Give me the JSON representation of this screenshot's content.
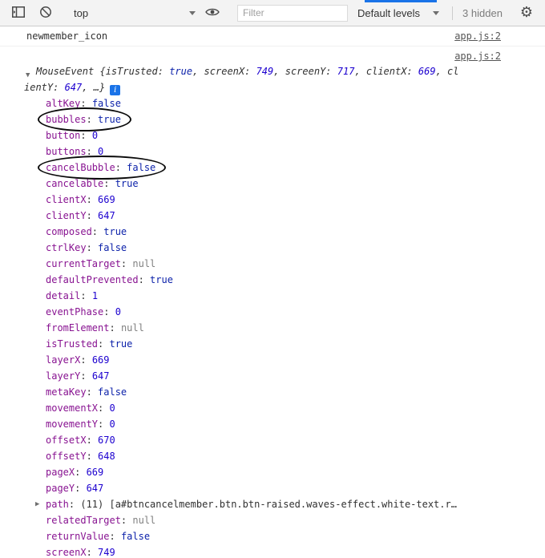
{
  "colors": {
    "accent_blue": "#1a73e8",
    "toolbar_background": "#f3f3f3",
    "property_name": "#881391",
    "number_value": "#1c00cf",
    "boolean_value": "#0d22aa",
    "null_value": "#808080",
    "source_link": "#555555",
    "annotation_circle": "#0a0a0a"
  },
  "icons": {
    "gear": "⚙",
    "expanded_arrow": "▼",
    "collapsed_arrow": "▶",
    "info": "i",
    "clear_console": "no-entry-circle",
    "console_sidebar": "sidebar-panel",
    "live_expression": "eye"
  },
  "toolbar": {
    "context_selector_label": "top",
    "filter_placeholder": "Filter",
    "levels_label": "Default levels",
    "hidden_label": "3 hidden"
  },
  "console": {
    "property_separator": ": ",
    "entry1": {
      "message": "newmember_icon",
      "source": "app.js:2"
    },
    "entry2": {
      "source": "app.js:2",
      "preview_line1": [
        {
          "t": "MouseEvent ",
          "c": "objname"
        },
        {
          "t": "{isTrusted: ",
          "c": "key"
        },
        {
          "t": "true",
          "c": "bool"
        },
        {
          "t": ", screenX: ",
          "c": "key"
        },
        {
          "t": "749",
          "c": "num"
        },
        {
          "t": ", screenY: ",
          "c": "key"
        },
        {
          "t": "717",
          "c": "num"
        },
        {
          "t": ", clientX: ",
          "c": "key"
        },
        {
          "t": "669",
          "c": "num"
        },
        {
          "t": ", cl",
          "c": "key"
        }
      ],
      "preview_line2": [
        {
          "t": "ientY: ",
          "c": "key"
        },
        {
          "t": "647",
          "c": "num"
        },
        {
          "t": ", …}",
          "c": "key"
        }
      ],
      "properties": [
        {
          "name": "altKey",
          "value": "false",
          "type": "bool"
        },
        {
          "name": "bubbles",
          "value": "true",
          "type": "bool",
          "circled": true
        },
        {
          "name": "button",
          "value": "0",
          "type": "num"
        },
        {
          "name": "buttons",
          "value": "0",
          "type": "num"
        },
        {
          "name": "cancelBubble",
          "value": "false",
          "type": "bool",
          "circled": true
        },
        {
          "name": "cancelable",
          "value": "true",
          "type": "bool"
        },
        {
          "name": "clientX",
          "value": "669",
          "type": "num"
        },
        {
          "name": "clientY",
          "value": "647",
          "type": "num"
        },
        {
          "name": "composed",
          "value": "true",
          "type": "bool"
        },
        {
          "name": "ctrlKey",
          "value": "false",
          "type": "bool"
        },
        {
          "name": "currentTarget",
          "value": "null",
          "type": "null"
        },
        {
          "name": "defaultPrevented",
          "value": "true",
          "type": "bool"
        },
        {
          "name": "detail",
          "value": "1",
          "type": "num"
        },
        {
          "name": "eventPhase",
          "value": "0",
          "type": "num"
        },
        {
          "name": "fromElement",
          "value": "null",
          "type": "null"
        },
        {
          "name": "isTrusted",
          "value": "true",
          "type": "bool"
        },
        {
          "name": "layerX",
          "value": "669",
          "type": "num"
        },
        {
          "name": "layerY",
          "value": "647",
          "type": "num"
        },
        {
          "name": "metaKey",
          "value": "false",
          "type": "bool"
        },
        {
          "name": "movementX",
          "value": "0",
          "type": "num"
        },
        {
          "name": "movementY",
          "value": "0",
          "type": "num"
        },
        {
          "name": "offsetX",
          "value": "670",
          "type": "num"
        },
        {
          "name": "offsetY",
          "value": "648",
          "type": "num"
        },
        {
          "name": "pageX",
          "value": "669",
          "type": "num"
        },
        {
          "name": "pageY",
          "value": "647",
          "type": "num"
        },
        {
          "name": "path",
          "value": "(11) [a#btncancelmember.btn.btn-raised.waves-effect.white-text.r…",
          "type": "preview",
          "expandable": true
        },
        {
          "name": "relatedTarget",
          "value": "null",
          "type": "null"
        },
        {
          "name": "returnValue",
          "value": "false",
          "type": "bool"
        },
        {
          "name": "screenX",
          "value": "749",
          "type": "num"
        }
      ]
    }
  }
}
